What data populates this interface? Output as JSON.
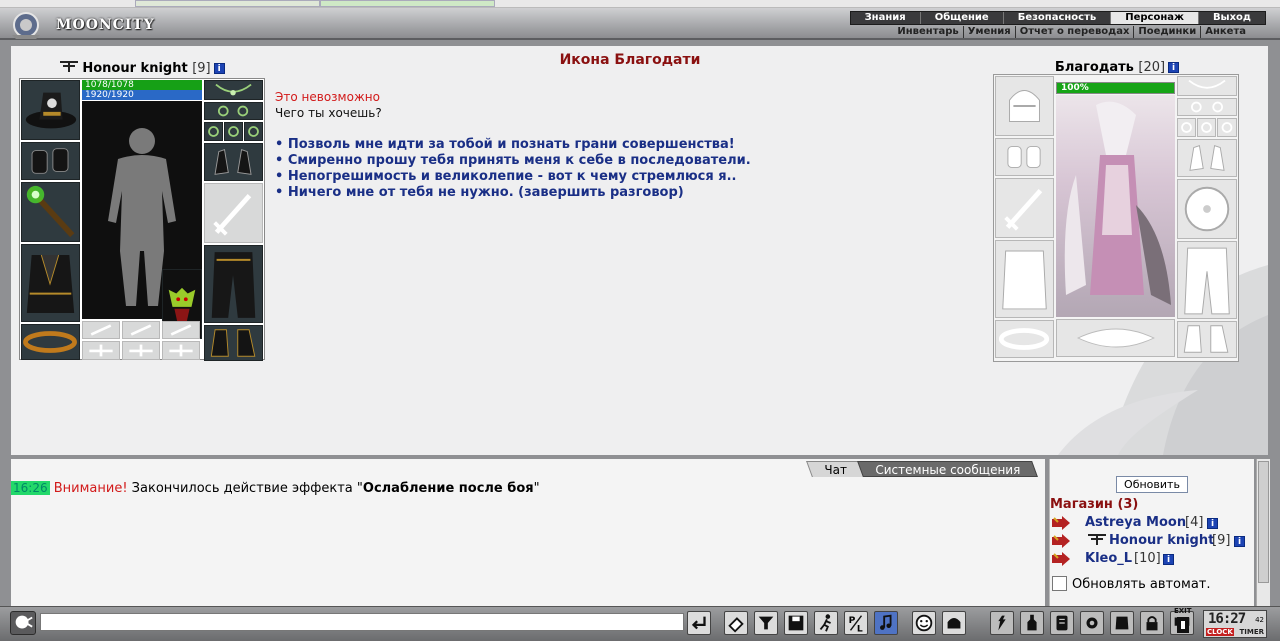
{
  "header": {
    "logo_text": "MOONCITY",
    "menu": [
      "Знания",
      "Общение",
      "Безопасность",
      "Персонаж",
      "Выход"
    ],
    "menu_selected": "Персонаж",
    "submenu": [
      "Инвентарь",
      "Умения",
      "Отчет о переводах",
      "Поединки",
      "Анкета"
    ]
  },
  "player": {
    "name": "Honour knight",
    "level": "[9]",
    "hp": "1078/1078",
    "mp": "1920/1920",
    "info_icon": "i"
  },
  "dialog": {
    "title": "Икона Благодати",
    "error": "Это невозможно",
    "question": "Чего ты хочешь?",
    "options": [
      "• Позволь мне идти за тобой и познать грани совершенства!",
      "• Смиренно прошу тебя принять меня к себе в последователи.",
      "• Непогрешимость и великолепие - вот к чему стремлюся я..",
      "• Ничего мне от тебя не нужно. (завершить разговор)"
    ]
  },
  "npc": {
    "name": "Благодать",
    "level": "[20]",
    "hp_label": "100%",
    "hp_fraction": 1.0
  },
  "chat": {
    "tabs": [
      "Чат",
      "Системные сообщения"
    ],
    "message": {
      "time": "16:26",
      "warning": "Внимание!",
      "text": " Закончилось действие эффекта \"",
      "effect": "Ослабление после боя",
      "end": "\""
    },
    "input_value": ""
  },
  "online": {
    "refresh_label": "Обновить",
    "location": "Магазин (3)",
    "users": [
      {
        "name": "Astreya Moon",
        "level": "[4]",
        "clan": false
      },
      {
        "name": "Honour knight",
        "level": "[9]",
        "clan": true
      },
      {
        "name": "Kleo_L",
        "level": "[10]",
        "clan": false
      }
    ],
    "auto_label": "Обновлять автомат."
  },
  "clock": {
    "time": "16:27",
    "seconds": "42",
    "clock_label": "CLOCK",
    "timer_label": "TIMER"
  },
  "toolbar": {
    "exit_label": "EXIT",
    "icons": [
      "enter-icon",
      "eraser-icon",
      "filter-icon",
      "save-icon",
      "running-man-icon",
      "translit-icon",
      "music-note-icon",
      "smiley-icon",
      "helmet-icon",
      "battle-icon",
      "bottle-icon",
      "scroll-icon",
      "gear-icon",
      "armor-icon",
      "lock-icon",
      "chat-bubble-icon",
      "exit-icon"
    ]
  },
  "colors": {
    "accent_red": "#8a1010",
    "link_blue": "#1a2f86",
    "hp_green": "#16a016",
    "mp_blue": "#2a69c6"
  }
}
